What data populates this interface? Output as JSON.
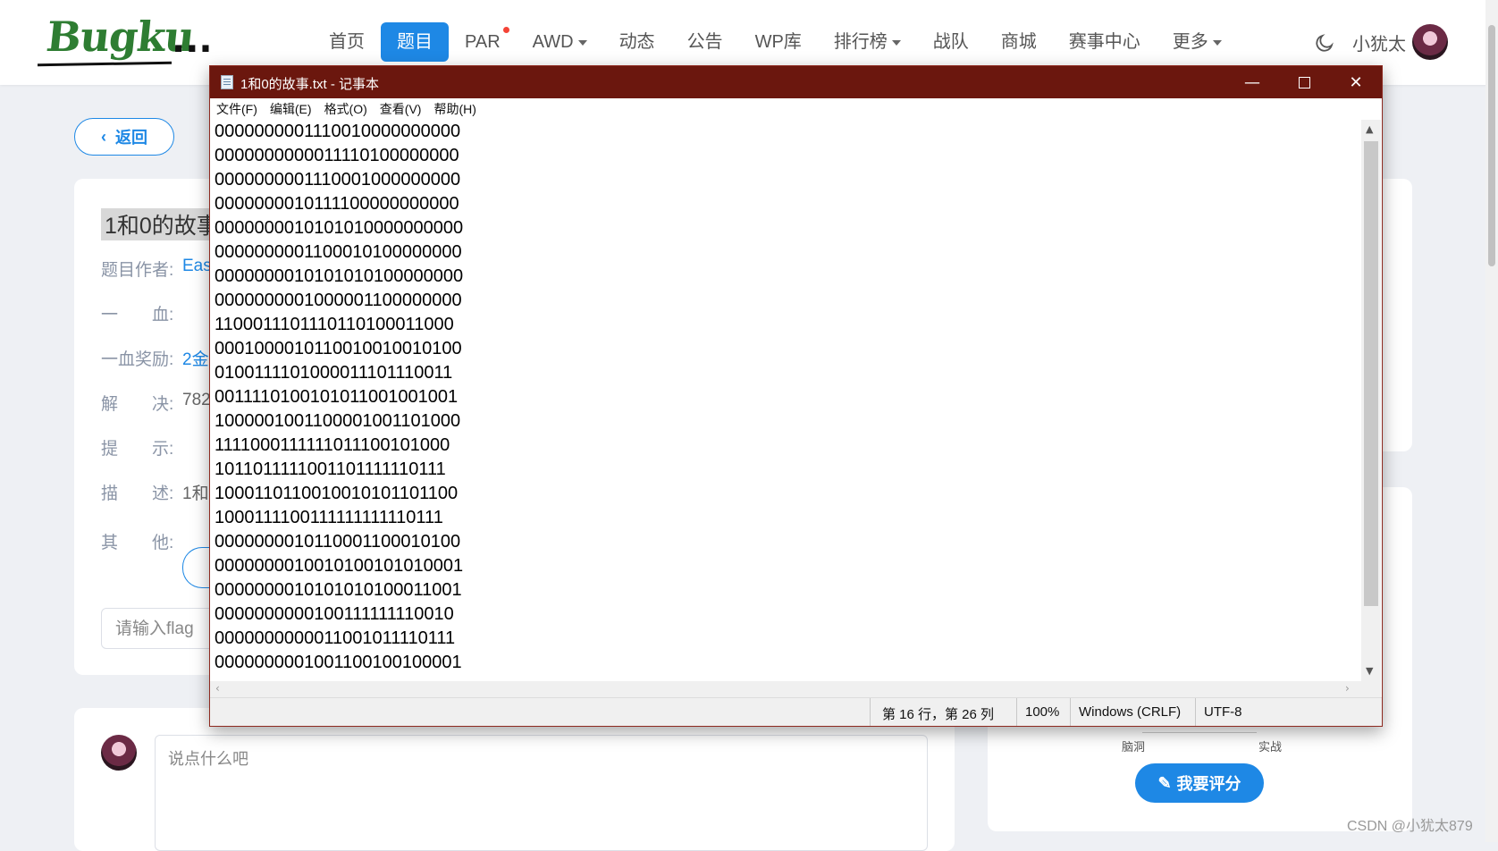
{
  "site": {
    "logo_text": "Bugku",
    "logo_suffix": "...",
    "nav": [
      {
        "label": "首页",
        "active": false
      },
      {
        "label": "题目",
        "active": true
      },
      {
        "label": "PAR",
        "active": false,
        "badge_dot": true
      },
      {
        "label": "AWD",
        "active": false,
        "dropdown": true
      },
      {
        "label": "动态",
        "active": false
      },
      {
        "label": "公告",
        "active": false
      },
      {
        "label": "WP库",
        "active": false
      },
      {
        "label": "排行榜",
        "active": false,
        "dropdown": true
      },
      {
        "label": "战队",
        "active": false
      },
      {
        "label": "商城",
        "active": false
      },
      {
        "label": "赛事中心",
        "active": false
      },
      {
        "label": "更多",
        "active": false,
        "dropdown": true
      }
    ],
    "username": "小犹太",
    "accent": "#1e88e5"
  },
  "page": {
    "back_label": "返回",
    "challenge_title": "1和0的故事",
    "rows": [
      {
        "label": "题目作者:",
        "value": "Eas"
      },
      {
        "label": "一　　血:",
        "value": ""
      },
      {
        "label": "一血奖励:",
        "value": "2金"
      },
      {
        "label": "解　　决:",
        "value": "782"
      },
      {
        "label": "提　　示:",
        "value": ""
      },
      {
        "label": "描　　述:",
        "value": "1和("
      },
      {
        "label": "其　　他:",
        "value": ""
      }
    ],
    "flag_placeholder": "请输入flag",
    "comment_placeholder": "说点什么吧",
    "radar_labels": [
      "脑洞",
      "实战"
    ],
    "rate_button": "我要评分",
    "watermark": "CSDN @小犹太879"
  },
  "notepad": {
    "title": "1和0的故事.txt - 记事本",
    "menu": [
      "文件(F)",
      "编辑(E)",
      "格式(O)",
      "查看(V)",
      "帮助(H)"
    ],
    "lines": [
      "0000000001110010000000000",
      "0000000000011110100000000",
      "0000000001110001000000000",
      "0000000010111100000000000",
      "0000000010101010000000000",
      "0000000001100010100000000",
      "0000000010101010100000000",
      "0000000001000001100000000",
      "1100011101110110100011000",
      "0001000010110010010010100",
      "0100111101000011101110011",
      "0011110100101011001001001",
      "1000001001100001001101000",
      "1111000111111011100101000",
      "1011011111001101111110111",
      "1000110110010010101101100",
      "1000111100111111111110111",
      "0000000010110001100010100",
      "0000000010010100101010001",
      "0000000010101010100011001",
      "0000000000100111111110010",
      "0000000000011001011110111",
      "0000000001001100100100001"
    ],
    "status": {
      "position": "第 16 行，第 26 列",
      "zoom": "100%",
      "line_ending": "Windows (CRLF)",
      "encoding": "UTF-8"
    },
    "title_bar_color": "#6b170e"
  }
}
